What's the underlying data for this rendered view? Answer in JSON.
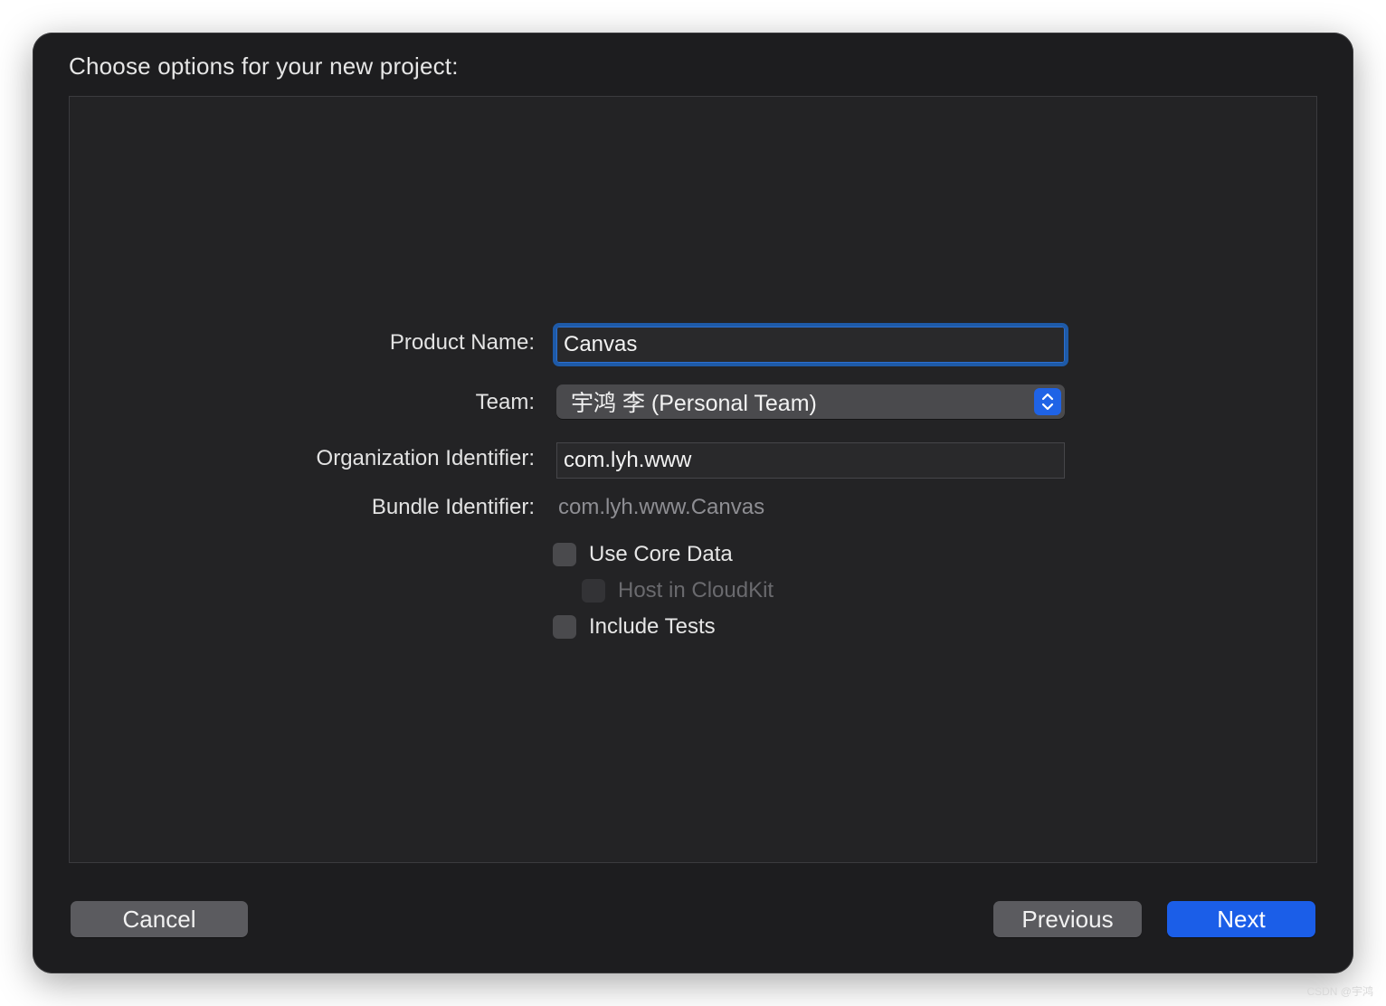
{
  "dialog": {
    "title": "Choose options for your new project:"
  },
  "form": {
    "product_name": {
      "label": "Product Name:",
      "value": "Canvas"
    },
    "team": {
      "label": "Team:",
      "value": "宇鸿 李 (Personal Team)"
    },
    "organization_identifier": {
      "label": "Organization Identifier:",
      "value": "com.lyh.www"
    },
    "bundle_identifier": {
      "label": "Bundle Identifier:",
      "value": "com.lyh.www.Canvas"
    },
    "checkboxes": [
      {
        "label": "Use Core Data",
        "checked": false,
        "enabled": true
      },
      {
        "label": "Host in CloudKit",
        "checked": false,
        "enabled": false
      },
      {
        "label": "Include Tests",
        "checked": false,
        "enabled": true
      }
    ]
  },
  "buttons": {
    "cancel": "Cancel",
    "previous": "Previous",
    "next": "Next"
  },
  "colors": {
    "accent": "#1b5ee8",
    "focus_ring": "#1e5aa8",
    "window_bg": "#1d1d1f",
    "panel_bg": "#232325"
  },
  "watermark": "CSDN @宇鸿"
}
